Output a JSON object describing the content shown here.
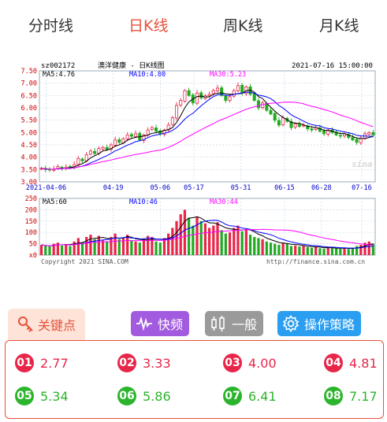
{
  "tabs": [
    {
      "label": "分时线",
      "active": false
    },
    {
      "label": "日K线",
      "active": true
    },
    {
      "label": "周K线",
      "active": false
    },
    {
      "label": "月K线",
      "active": false
    }
  ],
  "chart": {
    "code": "sz002172",
    "name": "澳洋健康 - 日K线图",
    "datetime": "2021-07-16 15:00:00",
    "ma5_label": "MA5:4.76",
    "ma10_label": "MA10:4.80",
    "ma30_label": "MA30:5.23",
    "vol_ma5_label": "MA5:60",
    "vol_ma10_label": "MA10:46",
    "vol_ma30_label": "MA30:44",
    "copyright": "Copyright 2021 SINA.COM",
    "url": "http://finance.sina.com.cn",
    "watermark": "sina",
    "colors": {
      "up": "#e8264a",
      "down": "#22aa22",
      "ma5": "#000000",
      "ma10": "#0000ff",
      "ma30": "#ff00ff",
      "grid": "#c8d8e8"
    }
  },
  "chart_data": {
    "type": "candlestick",
    "title": "澳洋健康 - 日K线图",
    "price_axis": {
      "ticks": [
        "7.50",
        "7.00",
        "6.50",
        "6.00",
        "5.50",
        "5.00",
        "4.50",
        "4.00",
        "3.50",
        "3.00"
      ],
      "ylim": [
        3.0,
        7.5
      ]
    },
    "volume_axis": {
      "ticks": [
        "250",
        "200",
        "150",
        "100",
        "50",
        "x0"
      ],
      "ylim": [
        0,
        250
      ]
    },
    "x_ticks": [
      "2021-04-06",
      "04-19",
      "05-06",
      "05-17",
      "05-31",
      "06-15",
      "06-28",
      "07-16"
    ],
    "close": [
      3.55,
      3.5,
      3.48,
      3.52,
      3.62,
      3.55,
      3.6,
      3.58,
      3.7,
      3.95,
      3.85,
      4.1,
      4.25,
      4.15,
      4.35,
      4.4,
      4.3,
      4.5,
      4.7,
      4.6,
      4.75,
      4.9,
      4.85,
      4.95,
      4.7,
      4.9,
      5.1,
      5.2,
      5.05,
      4.95,
      5.1,
      5.3,
      5.6,
      6.1,
      6.3,
      6.7,
      6.5,
      6.2,
      6.6,
      6.4,
      6.5,
      6.55,
      6.7,
      6.8,
      6.5,
      6.3,
      6.45,
      6.7,
      6.9,
      6.6,
      6.85,
      6.55,
      6.3,
      6.0,
      6.2,
      5.9,
      5.75,
      5.5,
      5.3,
      5.6,
      5.45,
      5.2,
      5.35,
      5.25,
      5.3,
      5.15,
      5.1,
      5.2,
      5.05,
      4.95,
      5.1,
      5.0,
      4.9,
      4.85,
      4.95,
      4.8,
      4.7,
      4.6,
      4.75,
      4.95,
      5.0,
      4.9
    ],
    "volume": [
      45,
      40,
      38,
      50,
      55,
      42,
      48,
      40,
      60,
      75,
      55,
      80,
      90,
      70,
      85,
      65,
      60,
      80,
      95,
      70,
      75,
      90,
      65,
      60,
      55,
      70,
      85,
      80,
      60,
      55,
      75,
      95,
      120,
      150,
      180,
      200,
      165,
      130,
      170,
      150,
      140,
      120,
      130,
      145,
      110,
      95,
      100,
      120,
      130,
      105,
      110,
      90,
      80,
      75,
      70,
      60,
      55,
      50,
      45,
      55,
      50,
      40,
      42,
      38,
      40,
      35,
      32,
      38,
      30,
      28,
      35,
      32,
      30,
      28,
      30,
      27,
      32,
      40,
      45,
      55,
      60,
      50
    ]
  },
  "mode_row": {
    "keypoints_label": "关键点",
    "fast_label": "快频",
    "normal_label": "一般",
    "strategy_label": "操作策略",
    "colors": {
      "fast": "#a25bdf",
      "normal": "#9a9a9a",
      "strategy": "#2a9ef0"
    }
  },
  "key_points": [
    {
      "no": "01",
      "value": "2.77",
      "tone": "red"
    },
    {
      "no": "02",
      "value": "3.33",
      "tone": "red"
    },
    {
      "no": "03",
      "value": "4.00",
      "tone": "red"
    },
    {
      "no": "04",
      "value": "4.81",
      "tone": "red"
    },
    {
      "no": "05",
      "value": "5.34",
      "tone": "green"
    },
    {
      "no": "06",
      "value": "5.86",
      "tone": "green"
    },
    {
      "no": "07",
      "value": "6.41",
      "tone": "green"
    },
    {
      "no": "08",
      "value": "7.17",
      "tone": "green"
    }
  ]
}
